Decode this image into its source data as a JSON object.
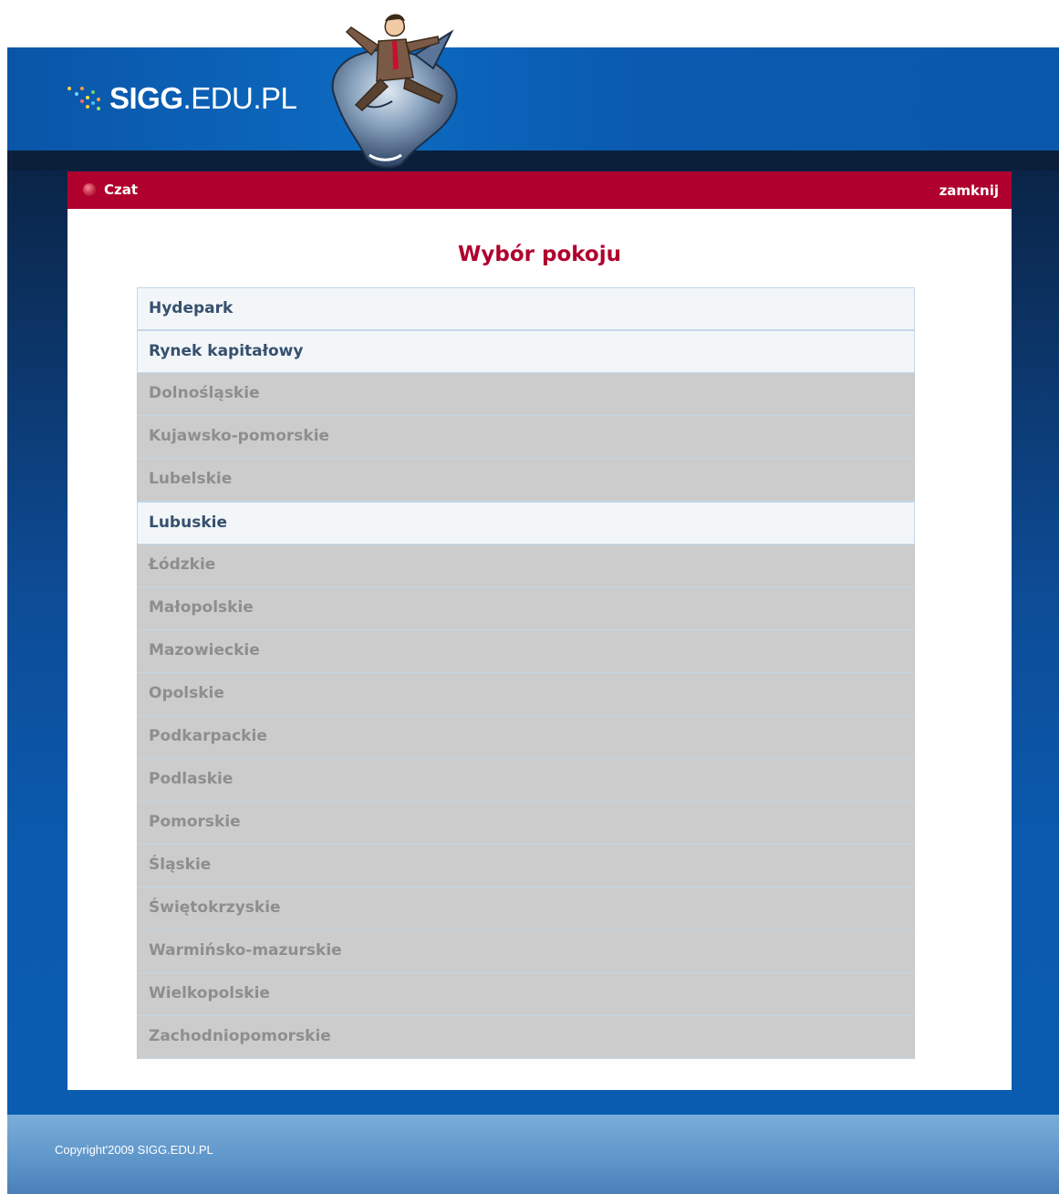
{
  "site": {
    "logo_bold": "SIGG",
    "logo_rest": ".EDU.PL"
  },
  "chat": {
    "title": "Czat",
    "close_label": "zamknij"
  },
  "room_selection": {
    "heading": "Wybór pokoju",
    "rooms": [
      {
        "label": "Hydepark",
        "active": true
      },
      {
        "label": "Rynek kapitałowy",
        "active": true
      },
      {
        "label": "Dolnośląskie",
        "active": false
      },
      {
        "label": "Kujawsko-pomorskie",
        "active": false
      },
      {
        "label": "Lubelskie",
        "active": false
      },
      {
        "label": "Lubuskie",
        "active": true
      },
      {
        "label": "Łódzkie",
        "active": false
      },
      {
        "label": "Małopolskie",
        "active": false
      },
      {
        "label": "Mazowieckie",
        "active": false
      },
      {
        "label": "Opolskie",
        "active": false
      },
      {
        "label": "Podkarpackie",
        "active": false
      },
      {
        "label": "Podlaskie",
        "active": false
      },
      {
        "label": "Pomorskie",
        "active": false
      },
      {
        "label": "Śląskie",
        "active": false
      },
      {
        "label": "Świętokrzyskie",
        "active": false
      },
      {
        "label": "Warmińsko-mazurskie",
        "active": false
      },
      {
        "label": "Wielkopolskie",
        "active": false
      },
      {
        "label": "Zachodniopomorskie",
        "active": false
      }
    ]
  },
  "footer": {
    "copyright": "Copyright'2009 SIGG.EDU.PL"
  },
  "colors": {
    "accent": "#b0002d",
    "active_text": "#36506e",
    "inactive_text": "#8e8e8e"
  },
  "icons": {
    "logo": "dots-logo-icon",
    "mascot": "shark-rider-mascot",
    "bar": "red-dot-icon"
  }
}
